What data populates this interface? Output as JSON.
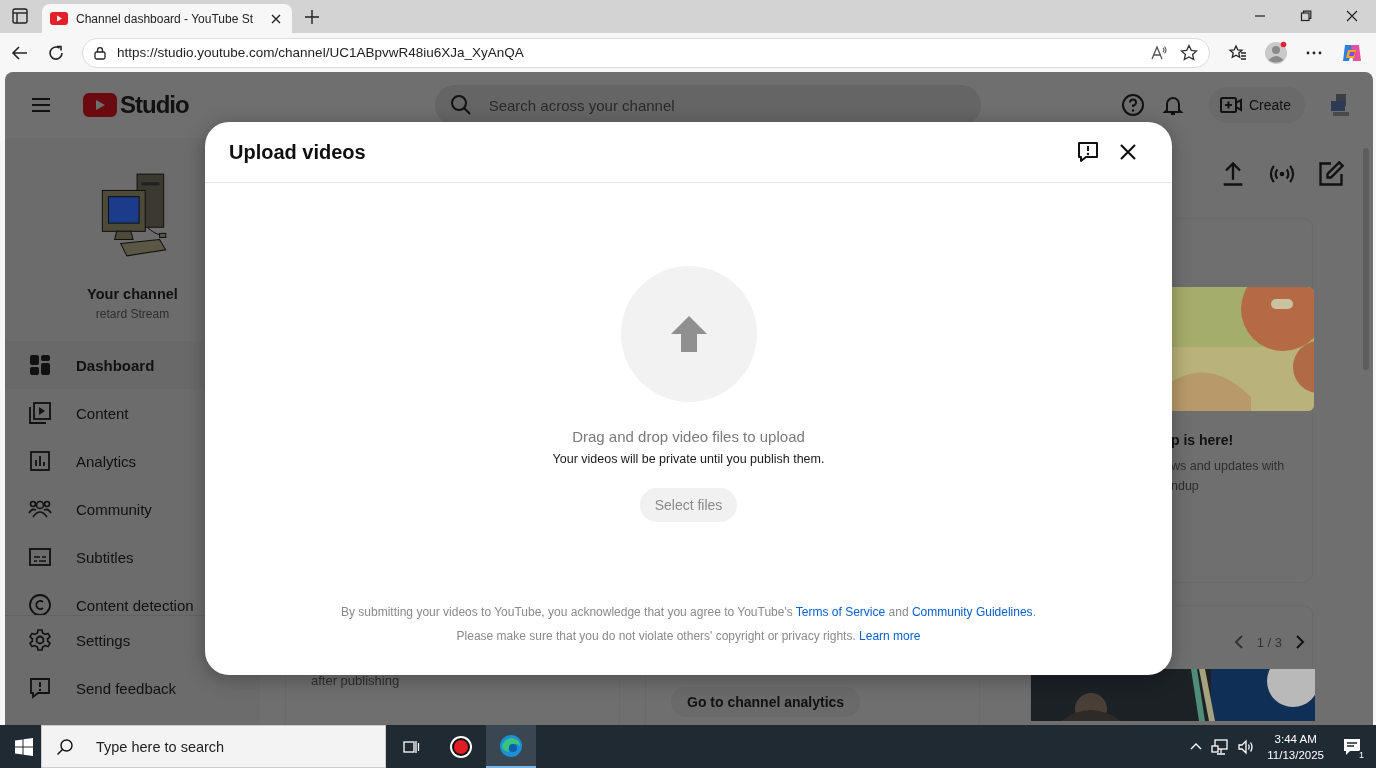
{
  "browser": {
    "tab": {
      "title": "Channel dashboard - YouTube St",
      "selected": true
    },
    "url": "https://studio.youtube.com/channel/UC1ABpvwR48iu6XJa_XyAnQA"
  },
  "header": {
    "logo": "Studio",
    "search_placeholder": "Search across your channel",
    "create": "Create"
  },
  "sidebar": {
    "channel_label": "Your channel",
    "channel_name": "retard Stream",
    "items": [
      {
        "label": "Dashboard",
        "kind": "dashboard",
        "selected": true
      },
      {
        "label": "Content",
        "kind": "content",
        "selected": false
      },
      {
        "label": "Analytics",
        "kind": "analytics",
        "selected": false
      },
      {
        "label": "Community",
        "kind": "community",
        "selected": false
      },
      {
        "label": "Subtitles",
        "kind": "subtitles",
        "selected": false
      },
      {
        "label": "Content detection",
        "kind": "detection",
        "selected": false
      }
    ],
    "footer_items": [
      {
        "label": "Settings",
        "kind": "settings"
      },
      {
        "label": "Send feedback",
        "kind": "feedback"
      }
    ]
  },
  "main": {
    "news_card": {
      "title": "p is here!",
      "text": "ws and updates with\nndup"
    },
    "pager": "1 / 3",
    "left_card_text": "after publishing",
    "analytics_button": "Go to channel analytics"
  },
  "dialog": {
    "title": "Upload videos",
    "drop_text": "Drag and drop video files to upload",
    "private_note": "Your videos will be private until you publish them.",
    "select_button": {
      "label": "Select files",
      "disabled": true
    },
    "footer": [
      [
        {
          "kind": "text",
          "text": "By submitting your videos to YouTube, you acknowledge that you agree to YouTube's "
        },
        {
          "kind": "link",
          "text": "Terms of Service"
        },
        {
          "kind": "text",
          "text": " and "
        },
        {
          "kind": "link",
          "text": "Community Guidelines"
        },
        {
          "kind": "text",
          "text": "."
        }
      ],
      [
        {
          "kind": "text",
          "text": "Please make sure that you do not violate others' copyright or privacy rights. "
        },
        {
          "kind": "link",
          "text": "Learn more"
        }
      ]
    ]
  },
  "taskbar": {
    "search_placeholder": "Type here to search",
    "apps": [
      {
        "kind": "taskview",
        "selected": false
      },
      {
        "kind": "recorder",
        "selected": false
      },
      {
        "kind": "edge",
        "selected": true
      }
    ],
    "time": "3:44 AM",
    "date": "11/13/2025",
    "notifications": "1"
  }
}
